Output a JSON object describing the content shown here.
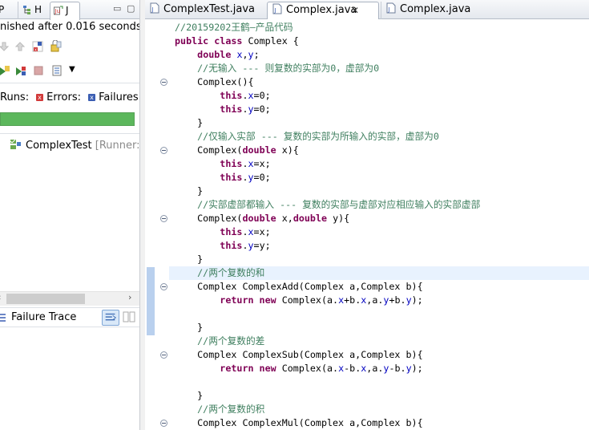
{
  "left_panel": {
    "tabs": [
      "P",
      "H",
      "J"
    ],
    "status": "nished after 0.016 seconds",
    "counts": {
      "runs_label": "Runs:",
      "errors_label": "Errors:",
      "failures_label": "Failures:"
    },
    "progress_color": "#5cb75c",
    "test_item": {
      "name": "ComplexTest",
      "runner": "[Runner: JU"
    },
    "failure_trace_label": "Failure Trace"
  },
  "editor": {
    "tabs": [
      "ComplexTest.java",
      "Complex.java",
      "Complex.java"
    ],
    "active_tab": 1,
    "lines": [
      [
        {
          "t": "//20159202王鹤—产品代码",
          "c": "cm"
        }
      ],
      [
        {
          "t": "public class",
          "c": "kw"
        },
        {
          "t": " Complex {",
          "c": "pl"
        }
      ],
      [
        {
          "t": "    ",
          "c": "pl"
        },
        {
          "t": "double",
          "c": "kw"
        },
        {
          "t": " ",
          "c": "pl"
        },
        {
          "t": "x",
          "c": "fd"
        },
        {
          "t": ",",
          "c": "pl"
        },
        {
          "t": "y",
          "c": "fd"
        },
        {
          "t": ";",
          "c": "pl"
        }
      ],
      [
        {
          "t": "    //无输入 --- 则复数的实部为0，虚部为0",
          "c": "cm"
        }
      ],
      [
        {
          "t": "    Complex(){",
          "c": "pl"
        }
      ],
      [
        {
          "t": "        ",
          "c": "pl"
        },
        {
          "t": "this",
          "c": "kw"
        },
        {
          "t": ".",
          "c": "pl"
        },
        {
          "t": "x",
          "c": "fd"
        },
        {
          "t": "=0;",
          "c": "pl"
        }
      ],
      [
        {
          "t": "        ",
          "c": "pl"
        },
        {
          "t": "this",
          "c": "kw"
        },
        {
          "t": ".",
          "c": "pl"
        },
        {
          "t": "y",
          "c": "fd"
        },
        {
          "t": "=0;",
          "c": "pl"
        }
      ],
      [
        {
          "t": "    }",
          "c": "pl"
        }
      ],
      [
        {
          "t": "    //仅输入实部 --- 复数的实部为所输入的实部，虚部为0",
          "c": "cm"
        }
      ],
      [
        {
          "t": "    Complex(",
          "c": "pl"
        },
        {
          "t": "double",
          "c": "kw"
        },
        {
          "t": " x){",
          "c": "pl"
        }
      ],
      [
        {
          "t": "        ",
          "c": "pl"
        },
        {
          "t": "this",
          "c": "kw"
        },
        {
          "t": ".",
          "c": "pl"
        },
        {
          "t": "x",
          "c": "fd"
        },
        {
          "t": "=x;",
          "c": "pl"
        }
      ],
      [
        {
          "t": "        ",
          "c": "pl"
        },
        {
          "t": "this",
          "c": "kw"
        },
        {
          "t": ".",
          "c": "pl"
        },
        {
          "t": "y",
          "c": "fd"
        },
        {
          "t": "=0;",
          "c": "pl"
        }
      ],
      [
        {
          "t": "    }",
          "c": "pl"
        }
      ],
      [
        {
          "t": "    //实部虚部都输入 --- 复数的实部与虚部对应相应输入的实部虚部",
          "c": "cm"
        }
      ],
      [
        {
          "t": "    Complex(",
          "c": "pl"
        },
        {
          "t": "double",
          "c": "kw"
        },
        {
          "t": " x,",
          "c": "pl"
        },
        {
          "t": "double",
          "c": "kw"
        },
        {
          "t": " y){",
          "c": "pl"
        }
      ],
      [
        {
          "t": "        ",
          "c": "pl"
        },
        {
          "t": "this",
          "c": "kw"
        },
        {
          "t": ".",
          "c": "pl"
        },
        {
          "t": "x",
          "c": "fd"
        },
        {
          "t": "=x;",
          "c": "pl"
        }
      ],
      [
        {
          "t": "        ",
          "c": "pl"
        },
        {
          "t": "this",
          "c": "kw"
        },
        {
          "t": ".",
          "c": "pl"
        },
        {
          "t": "y",
          "c": "fd"
        },
        {
          "t": "=y;",
          "c": "pl"
        }
      ],
      [
        {
          "t": "    }",
          "c": "pl"
        }
      ],
      [
        {
          "t": "    //两个复数的和",
          "c": "cm"
        }
      ],
      [
        {
          "t": "    Complex ComplexAdd(Complex a,Complex b){",
          "c": "pl"
        }
      ],
      [
        {
          "t": "        ",
          "c": "pl"
        },
        {
          "t": "return new",
          "c": "kw"
        },
        {
          "t": " Complex(a.",
          "c": "pl"
        },
        {
          "t": "x",
          "c": "fd"
        },
        {
          "t": "+b.",
          "c": "pl"
        },
        {
          "t": "x",
          "c": "fd"
        },
        {
          "t": ",a.",
          "c": "pl"
        },
        {
          "t": "y",
          "c": "fd"
        },
        {
          "t": "+b.",
          "c": "pl"
        },
        {
          "t": "y",
          "c": "fd"
        },
        {
          "t": ");",
          "c": "pl"
        }
      ],
      [
        {
          "t": "",
          "c": "pl"
        }
      ],
      [
        {
          "t": "    }",
          "c": "pl"
        }
      ],
      [
        {
          "t": "    //两个复数的差",
          "c": "cm"
        }
      ],
      [
        {
          "t": "    Complex ComplexSub(Complex a,Complex b){",
          "c": "pl"
        }
      ],
      [
        {
          "t": "        ",
          "c": "pl"
        },
        {
          "t": "return new",
          "c": "kw"
        },
        {
          "t": " Complex(a.",
          "c": "pl"
        },
        {
          "t": "x",
          "c": "fd"
        },
        {
          "t": "-b.",
          "c": "pl"
        },
        {
          "t": "x",
          "c": "fd"
        },
        {
          "t": ",a.",
          "c": "pl"
        },
        {
          "t": "y",
          "c": "fd"
        },
        {
          "t": "-b.",
          "c": "pl"
        },
        {
          "t": "y",
          "c": "fd"
        },
        {
          "t": ");",
          "c": "pl"
        }
      ],
      [
        {
          "t": "",
          "c": "pl"
        }
      ],
      [
        {
          "t": "    }",
          "c": "pl"
        }
      ],
      [
        {
          "t": "    //两个复数的积",
          "c": "cm"
        }
      ],
      [
        {
          "t": "    Complex ComplexMul(Complex a,Complex b){",
          "c": "pl"
        }
      ]
    ],
    "fold_lines": [
      4,
      9,
      14,
      19,
      24,
      29
    ],
    "current_line": 18
  }
}
